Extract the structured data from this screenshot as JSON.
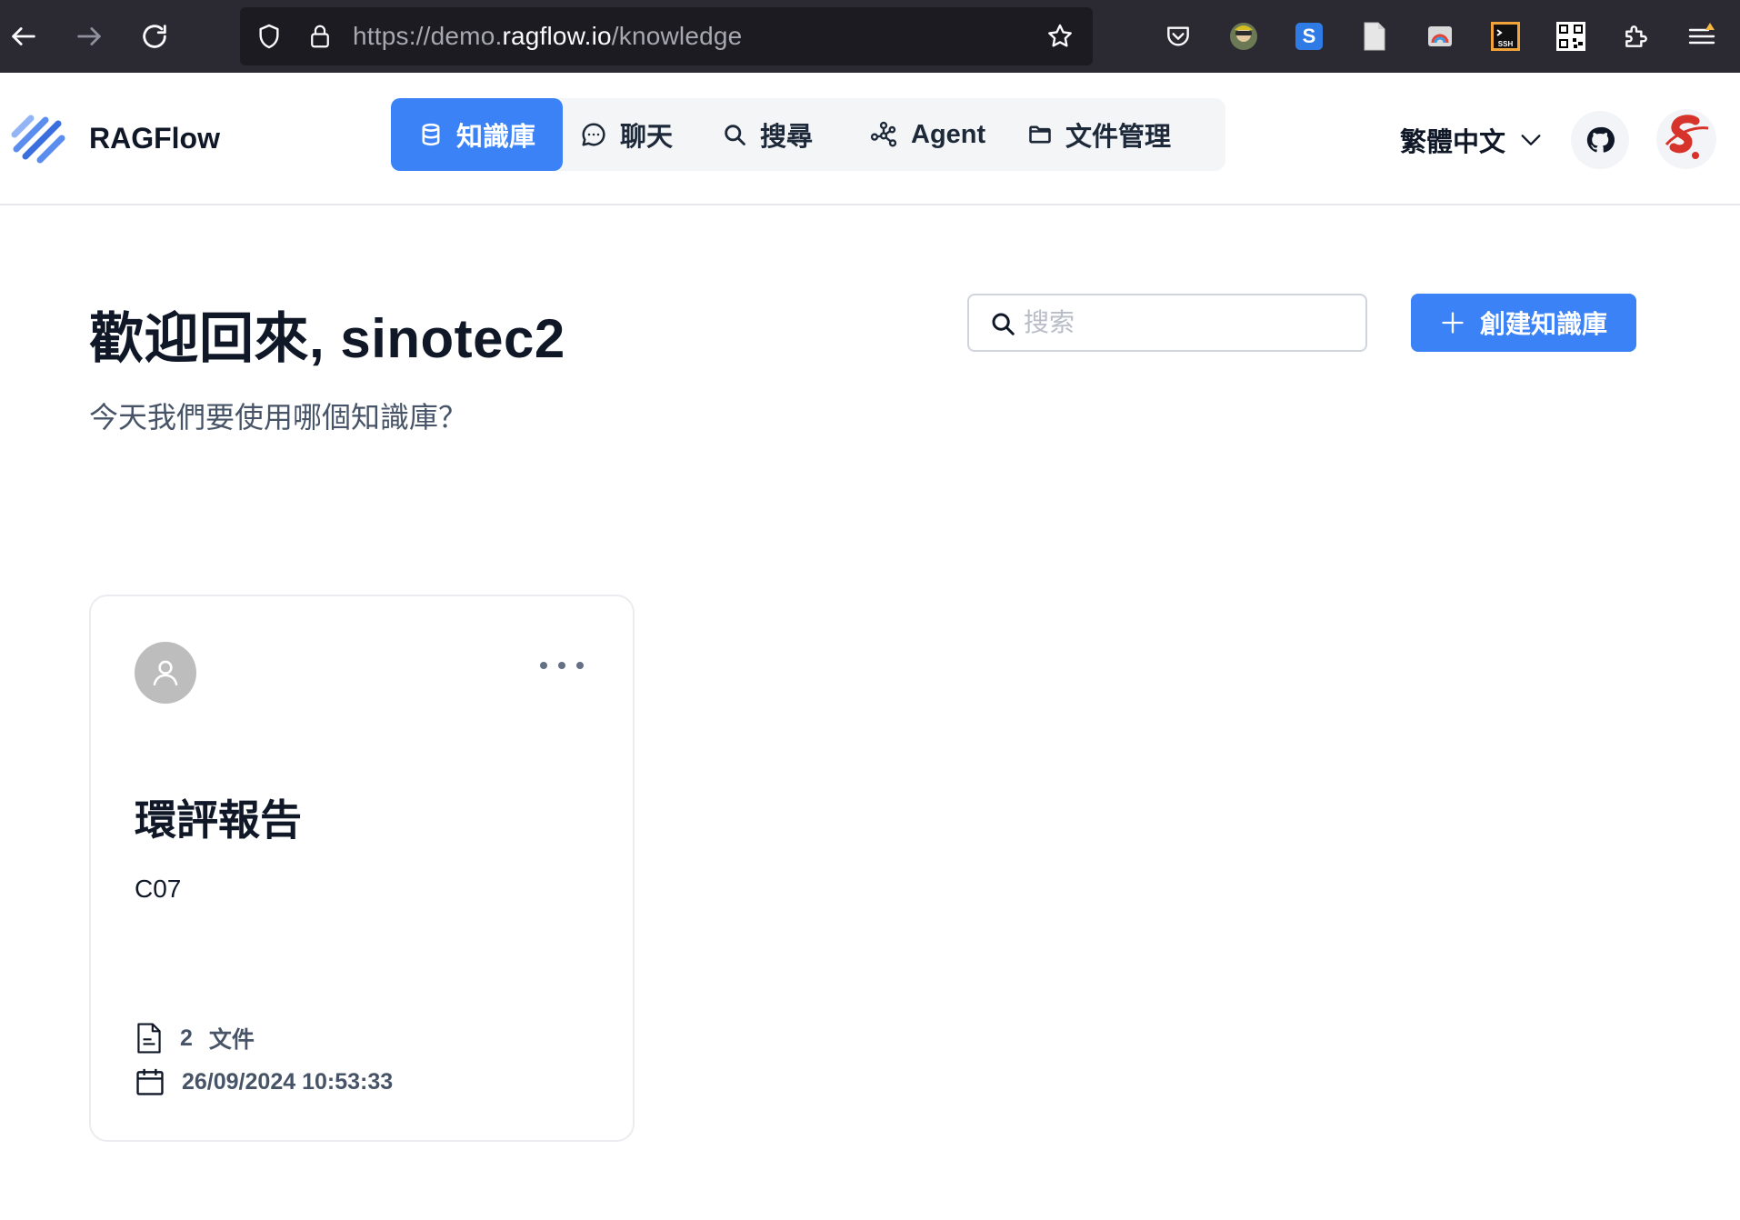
{
  "browser": {
    "url_prefix": "https://demo.",
    "url_host": "ragflow.io",
    "url_path": "/knowledge",
    "icons": [
      "back-arrow-icon",
      "forward-arrow-icon",
      "reload-icon",
      "shield-icon",
      "lock-icon",
      "star-icon",
      "pocket-icon",
      "profile-extension-icon",
      "s-extension-icon",
      "document-extension-icon",
      "rainbow-extension-icon",
      "ssh-extension-icon",
      "qr-code-extension-icon",
      "puzzle-extensions-icon",
      "menu-icon"
    ],
    "ssh_label": "SSH",
    "s_label": "S"
  },
  "header": {
    "brand": "RAGFlow",
    "nav": [
      {
        "label": "知識庫",
        "icon": "database-icon",
        "active": true
      },
      {
        "label": "聊天",
        "icon": "chat-icon",
        "active": false
      },
      {
        "label": "搜尋",
        "icon": "search-icon",
        "active": false
      },
      {
        "label": "Agent",
        "icon": "agent-graph-icon",
        "active": false
      },
      {
        "label": "文件管理",
        "icon": "folder-icon",
        "active": false
      }
    ],
    "language": "繁體中文",
    "accent_color": "#3b82f6"
  },
  "main": {
    "welcome": "歡迎回來, sinotec2",
    "subtitle": "今天我們要使用哪個知識庫？",
    "search_placeholder": "搜索",
    "create_button": "創建知識庫"
  },
  "knowledge_bases": [
    {
      "title": "環評報告",
      "description": "C07",
      "doc_count": "2",
      "doc_unit": "文件",
      "updated": "26/09/2024 10:53:33"
    }
  ]
}
